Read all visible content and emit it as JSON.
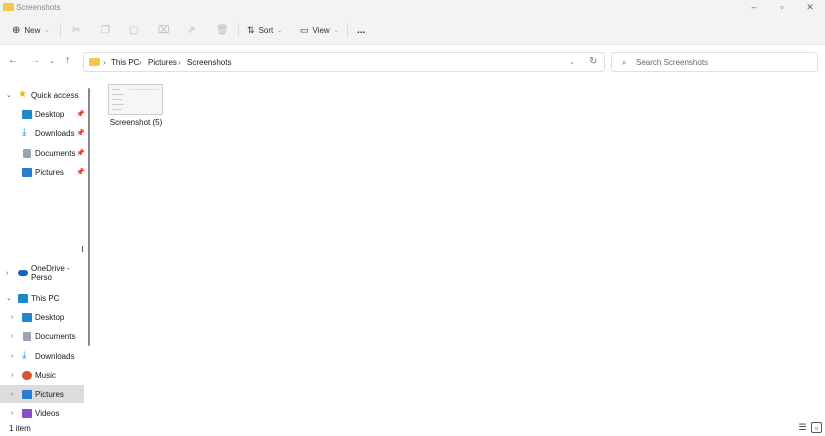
{
  "window": {
    "title": "Screenshots",
    "controls": [
      "minimize",
      "restore",
      "close"
    ]
  },
  "toolbar": {
    "new_label": "New",
    "sort_label": "Sort",
    "view_label": "View",
    "more_label": "...",
    "disabled_icons": [
      "cut-icon",
      "copy-icon",
      "paste-icon",
      "rename-icon",
      "share-icon",
      "delete-icon"
    ]
  },
  "address": {
    "crumbs": [
      "This PC",
      "Pictures",
      "Screenshots"
    ]
  },
  "search": {
    "placeholder": "Search Screenshots"
  },
  "sidebar": {
    "quick_access": {
      "label": "Quick access",
      "items": [
        {
          "label": "Desktop"
        },
        {
          "label": "Downloads"
        },
        {
          "label": "Documents"
        },
        {
          "label": "Pictures"
        }
      ]
    },
    "onedrive": {
      "label": "OneDrive - Perso"
    },
    "this_pc": {
      "label": "This PC",
      "items": [
        {
          "label": "Desktop"
        },
        {
          "label": "Documents"
        },
        {
          "label": "Downloads"
        },
        {
          "label": "Music"
        },
        {
          "label": "Pictures",
          "selected": true
        },
        {
          "label": "Videos"
        }
      ]
    }
  },
  "files": [
    {
      "name": "Screenshot (5)"
    }
  ],
  "status": {
    "count": "1 item"
  },
  "colors": {
    "folder": "#f2c94c",
    "selected": "#dcdcdc",
    "toolbar_bg": "#f3f3f3"
  }
}
